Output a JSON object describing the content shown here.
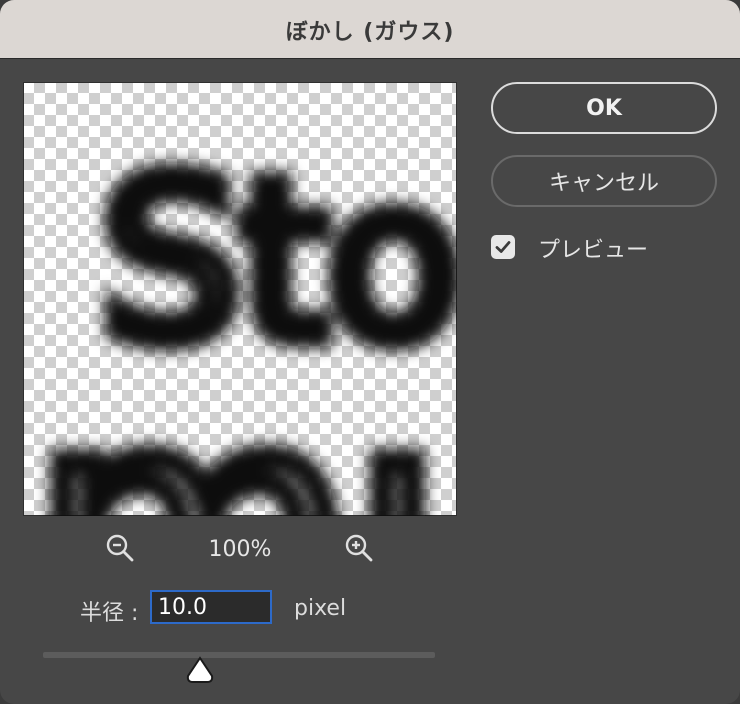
{
  "dialog": {
    "title": "ぼかし (ガウス)"
  },
  "preview": {
    "zoom_level": "100%",
    "blurred_text_line1": "Sto",
    "blurred_text_line2": "mu"
  },
  "radius": {
    "label": "半径 :",
    "value": "10.0",
    "unit": "pixel",
    "slider_fraction": 0.4
  },
  "buttons": {
    "ok_label": "OK",
    "cancel_label": "キャンセル"
  },
  "preview_checkbox": {
    "label": "プレビュー",
    "checked": true
  },
  "colors": {
    "accent": "#2d6ac9",
    "dialog_bg": "#474747",
    "titlebar_bg": "#dcd7d3"
  },
  "icons": {
    "zoom_out": "zoom-out-icon",
    "zoom_in": "zoom-in-icon",
    "checkmark": "checkmark-icon",
    "slider_thumb": "slider-thumb"
  }
}
